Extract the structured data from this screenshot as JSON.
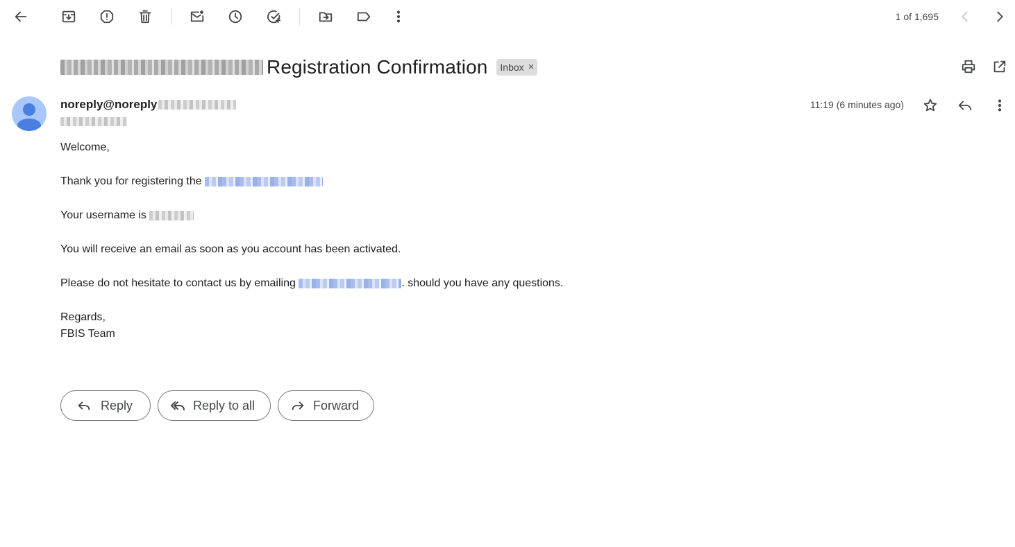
{
  "toolbar": {
    "icons": [
      "back-arrow-icon",
      "archive-icon",
      "report-spam-icon",
      "delete-icon",
      "mark-unread-icon",
      "snooze-icon",
      "add-to-tasks-icon",
      "move-to-icon",
      "label-icon",
      "more-vert-icon"
    ],
    "pager_text": "1 of 1,695"
  },
  "message": {
    "subject": "Registration Confirmation",
    "label": "Inbox",
    "label_remove": "×",
    "sender": "noreply@noreply",
    "timestamp": "11:19 (6 minutes ago)",
    "body": {
      "greeting": "Welcome,",
      "line1_prefix": "Thank you for registering the",
      "line2_prefix": "Your username is",
      "line3": "You will receive an email as soon as you account has been activated.",
      "line4_prefix": "Please do not hesitate to contact us by emailing",
      "line4_suffix": ". should you have any questions.",
      "sign_off": "Regards,",
      "signature": "FBIS Team"
    }
  },
  "actions": {
    "reply": "Reply",
    "reply_all": "Reply to all",
    "forward": "Forward"
  },
  "colors": {
    "avatar_bg": "#a8c7fa",
    "avatar_fg": "#4a7fe0",
    "link": "#1a73e8"
  }
}
